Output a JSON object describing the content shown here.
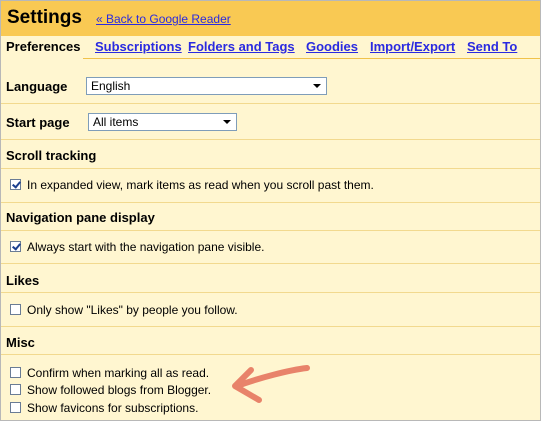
{
  "header": {
    "title": "Settings",
    "back_link": "« Back to Google Reader"
  },
  "tabs": [
    {
      "label": "Preferences",
      "active": true
    },
    {
      "label": "Subscriptions",
      "active": false
    },
    {
      "label": "Folders and Tags",
      "active": false
    },
    {
      "label": "Goodies",
      "active": false
    },
    {
      "label": "Import/Export",
      "active": false
    },
    {
      "label": "Send To",
      "active": false
    }
  ],
  "language": {
    "label": "Language",
    "value": "English"
  },
  "start_page": {
    "label": "Start page",
    "value": "All items"
  },
  "scroll_tracking": {
    "heading": "Scroll tracking",
    "option": {
      "label": "In expanded view, mark items as read when you scroll past them.",
      "checked": true
    }
  },
  "navigation_pane": {
    "heading": "Navigation pane display",
    "option": {
      "label": "Always start with the navigation pane visible.",
      "checked": true
    }
  },
  "likes": {
    "heading": "Likes",
    "option": {
      "label": "Only show \"Likes\" by people you follow.",
      "checked": false
    }
  },
  "misc": {
    "heading": "Misc",
    "options": [
      {
        "label": "Confirm when marking all as read.",
        "checked": false
      },
      {
        "label": "Show followed blogs from Blogger.",
        "checked": false
      },
      {
        "label": "Show favicons for subscriptions.",
        "checked": false
      }
    ]
  },
  "colors": {
    "header_bg": "#f9c953",
    "panel_bg": "#fff6d0",
    "link": "#2a2ae0",
    "annotation": "#e8836a"
  }
}
